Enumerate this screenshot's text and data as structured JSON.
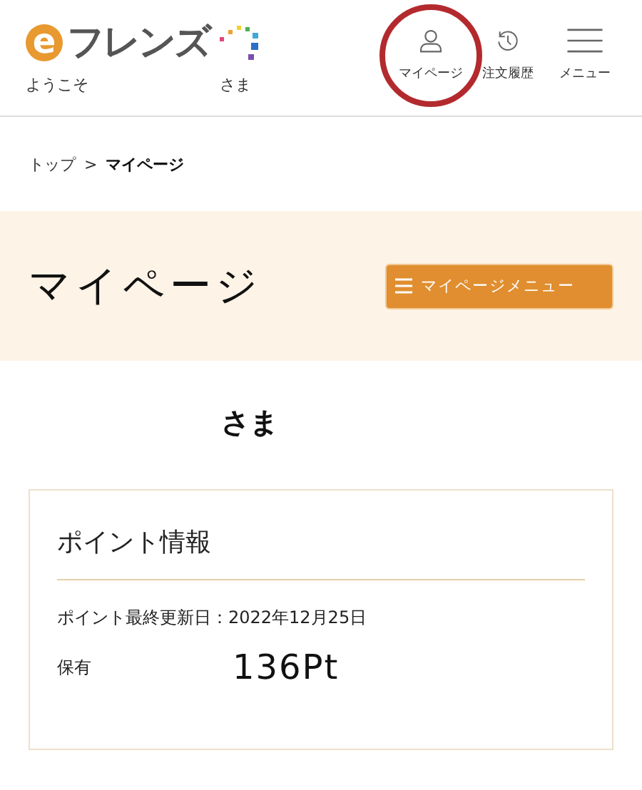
{
  "header": {
    "logo": {
      "mark": "e",
      "text": "フレンズ"
    },
    "greeting": "ようこそ",
    "honorific": "さま",
    "nav": [
      {
        "kind": "person",
        "label": "マイページ",
        "circled": true
      },
      {
        "kind": "history",
        "label": "注文履歴",
        "circled": false
      },
      {
        "kind": "menu",
        "label": "メニュー",
        "circled": false
      }
    ]
  },
  "breadcrumb": [
    {
      "label": "トップ",
      "current": false
    },
    {
      "label": "マイページ",
      "current": true
    }
  ],
  "breadcrumb_separator": ">",
  "banner": {
    "title": "マイページ",
    "menu_button": "マイページメニュー"
  },
  "user_name": "さま",
  "point_card": {
    "title": "ポイント情報",
    "updated": "ポイント最終更新日：2022年12月25日",
    "holding_label": "保有",
    "holding_value": "136Pt"
  }
}
